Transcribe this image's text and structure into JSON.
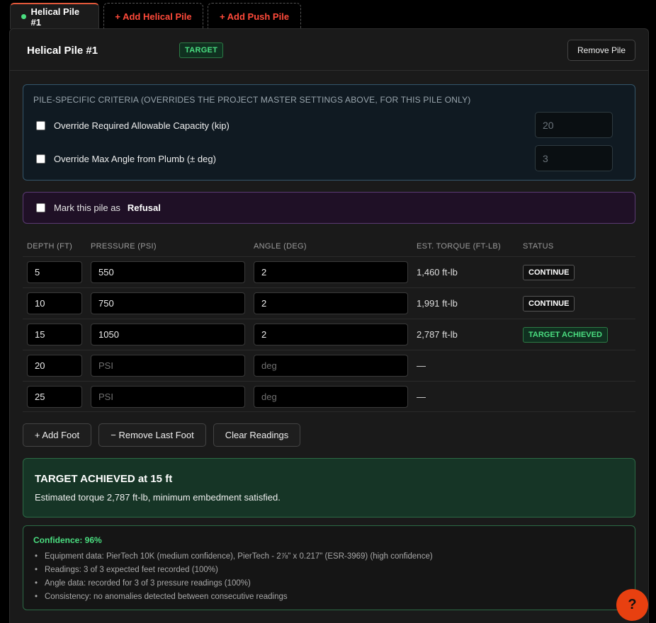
{
  "tabs": [
    {
      "label": "Helical Pile #1"
    },
    {
      "label": "+ Add Helical Pile"
    },
    {
      "label": "+ Add Push Pile"
    }
  ],
  "pile": {
    "title": "Helical Pile #1",
    "badge": "TARGET",
    "remove_label": "Remove Pile"
  },
  "criteria": {
    "title": "PILE-SPECIFIC CRITERIA (OVERRIDES THE PROJECT MASTER SETTINGS ABOVE, FOR THIS PILE ONLY)",
    "capacity_label": "Override Required Allowable Capacity (kip)",
    "capacity_placeholder": "20",
    "angle_label": "Override Max Angle from Plumb (± deg)",
    "angle_placeholder": "3"
  },
  "refusal": {
    "label": "Mark this pile as",
    "value": "Refusal"
  },
  "table": {
    "headers": [
      "DEPTH (FT)",
      "PRESSURE (PSI)",
      "ANGLE (DEG)",
      "EST. TORQUE (FT-LB)",
      "STATUS"
    ],
    "rows": [
      {
        "depth": "5",
        "pressure": "550",
        "angle": "2",
        "torque": "1,460 ft-lb",
        "status": "CONTINUE"
      },
      {
        "depth": "10",
        "pressure": "750",
        "angle": "2",
        "torque": "1,991 ft-lb",
        "status": "CONTINUE"
      },
      {
        "depth": "15",
        "pressure": "1050",
        "angle": "2",
        "torque": "2,787 ft-lb",
        "status": "TARGET ACHIEVED"
      },
      {
        "depth": "20",
        "pressure": "PSI",
        "angle": "deg",
        "torque": "—",
        "status": ""
      },
      {
        "depth": "25",
        "pressure": "PSI",
        "angle": "deg",
        "torque": "—",
        "status": ""
      }
    ]
  },
  "buttons": {
    "add_foot": "+ Add Foot",
    "remove_foot": "− Remove Last Foot",
    "clear": "Clear Readings"
  },
  "result": {
    "title": "TARGET ACHIEVED at 15 ft",
    "text": "Estimated torque 2,787 ft-lb, minimum embedment satisfied."
  },
  "confidence": {
    "title": "Confidence: 96%",
    "items": [
      "Equipment data: PierTech 10K (medium confidence), PierTech - 2⅞\" x 0.217\" (ESR-3969) (high confidence)",
      "Readings: 3 of 3 expected feet recorded (100%)",
      "Angle data: recorded for 3 of 3 pressure readings (100%)",
      "Consistency: no anomalies detected between consecutive readings"
    ]
  },
  "help": {
    "label": "?"
  },
  "colors": {
    "accent_orange": "#e84010",
    "success_green": "#4ade80",
    "add_tab_red": "#ff4a3a"
  }
}
